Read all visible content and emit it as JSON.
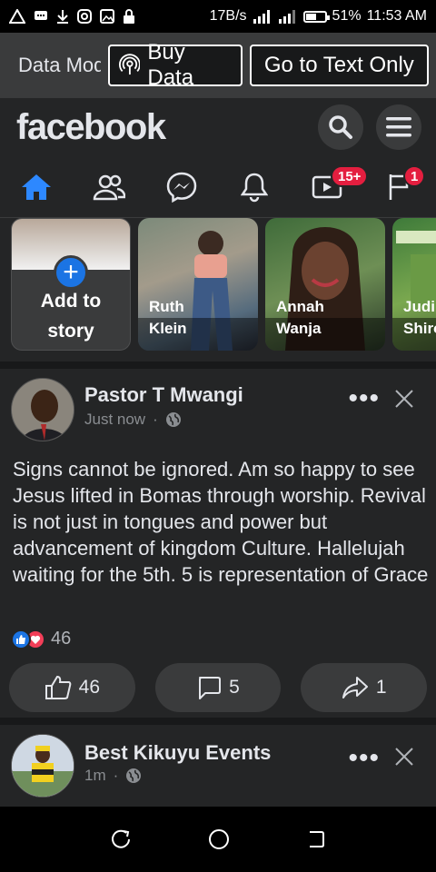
{
  "status_bar": {
    "speed": "17B/s",
    "battery": "51%",
    "time": "11:53 AM"
  },
  "data_bar": {
    "label": "Data Mode",
    "buy_data": "Buy Data",
    "text_only": "Go to Text Only"
  },
  "header": {
    "logo": "facebook",
    "search_icon": "search-icon",
    "menu_icon": "menu-icon"
  },
  "tabs": [
    {
      "name": "home",
      "icon": "home-icon",
      "active": true,
      "badge": ""
    },
    {
      "name": "friends",
      "icon": "friends-icon",
      "badge": ""
    },
    {
      "name": "messenger",
      "icon": "messenger-icon",
      "badge": ""
    },
    {
      "name": "notifications",
      "icon": "bell-icon",
      "badge": ""
    },
    {
      "name": "watch",
      "icon": "video-icon",
      "badge": "15+"
    },
    {
      "name": "pages",
      "icon": "flag-icon",
      "badge": "1"
    }
  ],
  "stories": {
    "add_label": "Add to\nstory",
    "items": [
      {
        "name": "Ruth\nKlein"
      },
      {
        "name": "Annah\nWanja"
      },
      {
        "name": "Judi\nShiro"
      }
    ]
  },
  "posts": [
    {
      "author": "Pastor T Mwangi",
      "time": "Just now",
      "text": "Signs cannot be ignored. Am so happy to see Jesus lifted in Bomas through worship. Revival is not just in tongues and power but advancement of kingdom Culture.  Hallelujah waiting for the 5th. 5 is representation of Grace",
      "reaction_count": "46",
      "like_count": "46",
      "comment_count": "5",
      "share_count": "1"
    },
    {
      "author": "Best Kikuyu Events",
      "time": "1m"
    }
  ],
  "colors": {
    "accent": "#1b74e4",
    "badge": "#e41e3f",
    "surface": "#242526",
    "button": "#3a3b3c"
  }
}
